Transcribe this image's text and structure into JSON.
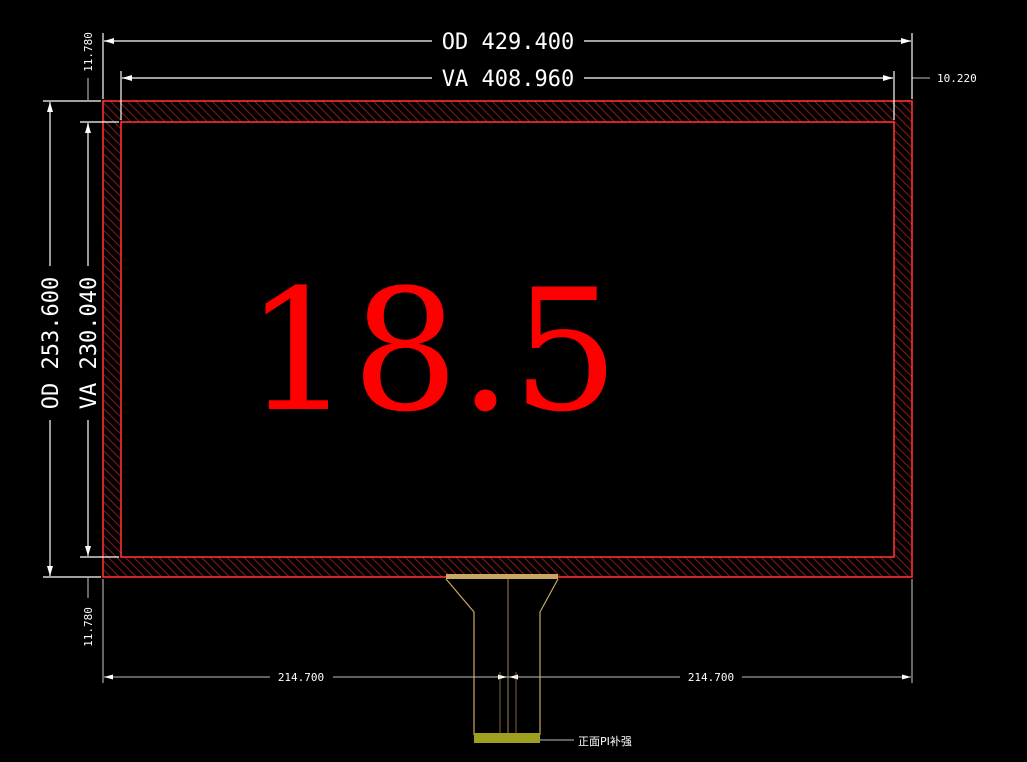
{
  "drawing": {
    "size_label": "18.5",
    "dimensions": {
      "od_width": "OD 429.400",
      "va_width": "VA 408.960",
      "od_height": "OD 253.600",
      "va_height": "VA 230.040",
      "border_top": "11.780",
      "border_bottom": "11.780",
      "border_right": "10.220",
      "half_width_left": "214.700",
      "half_width_right": "214.700"
    },
    "fpc_note": "正面PI补强",
    "colors": {
      "background": "#000000",
      "outline": "#ff2a2a",
      "dimension_lines": "#ffffff",
      "size_label": "#ff0000",
      "fpc": "#c8a860",
      "stiffener": "#a0a020"
    }
  }
}
